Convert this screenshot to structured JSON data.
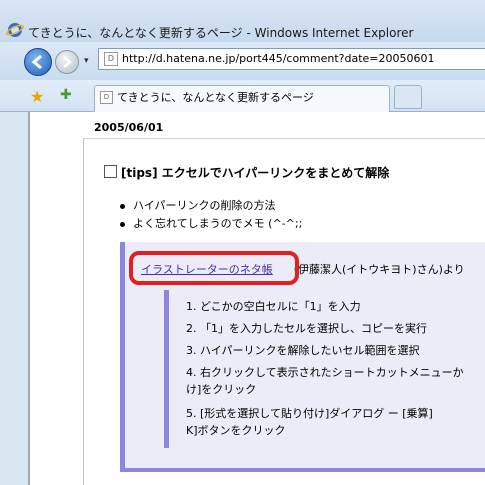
{
  "window": {
    "title": "てきとうに、なんとなく更新するページ - Windows Internet Explorer"
  },
  "nav": {
    "address": "http://d.hatena.ne.jp/port445/comment?date=20050601",
    "address_icon": "D",
    "dropdown": "▾"
  },
  "tabs": [
    {
      "label": "てきとうに、なんとなく更新するページ",
      "icon": "D"
    }
  ],
  "page": {
    "date": "2005/06/01",
    "entry": {
      "category": "[tips]",
      "title": "エクセルでハイパーリンクをまとめて解除",
      "bullets": [
        "ハイパーリンクの削除の方法",
        "よく忘れてしまうのでメモ (^-^;;"
      ],
      "quote": {
        "source_link": "イラストレーターのネタ帳",
        "source_suffix": "（伊藤潔人(イトウキヨト)さん)より",
        "steps": [
          "1. どこかの空白セルに「1」を入力",
          "2. 「1」を入力したセルを選択し、コピーを実行",
          "3. ハイパーリンクを解除したいセル範囲を選択",
          "4. 右クリックして表示されたショートカットメニューか",
          "け]をクリック",
          "5. [形式を選択して貼り付け]ダイアログ ー [乗算]",
          "K]ボタンをクリック"
        ]
      }
    }
  },
  "colors": {
    "highlight": "#e02020",
    "quote_bar": "#8d86e0",
    "quote_bg": "#ececf8",
    "link": "#4b2fa8"
  }
}
